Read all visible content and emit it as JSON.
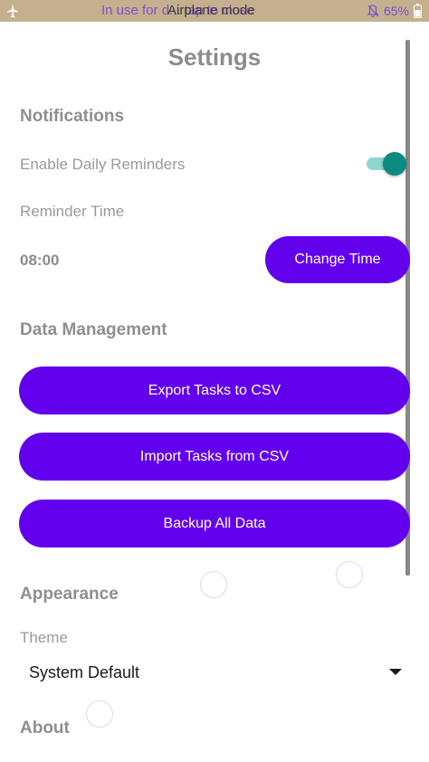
{
  "status_bar": {
    "overlay_text": "In use for d... tap to close",
    "title": "Airplane mode",
    "battery_percent": "65%",
    "left_icon": "airplane-icon",
    "colors": {
      "background": "#c4b08e",
      "overlay": "#8a4bd1"
    }
  },
  "page": {
    "title": "Settings"
  },
  "notifications": {
    "heading": "Notifications",
    "daily_reminders_label": "Enable Daily Reminders",
    "daily_reminders_enabled": true,
    "reminder_time_label": "Reminder Time",
    "reminder_time_value": "08:00",
    "change_time_label": "Change Time"
  },
  "data_management": {
    "heading": "Data Management",
    "export_label": "Export Tasks to CSV",
    "import_label": "Import Tasks from CSV",
    "backup_label": "Backup All Data"
  },
  "appearance": {
    "heading": "Appearance",
    "theme_label": "Theme",
    "theme_value": "System Default"
  },
  "about": {
    "heading": "About"
  },
  "colors": {
    "accent": "#6200ee",
    "toggle_on": "#0a8a80",
    "toggle_track": "#8fd6cf"
  }
}
